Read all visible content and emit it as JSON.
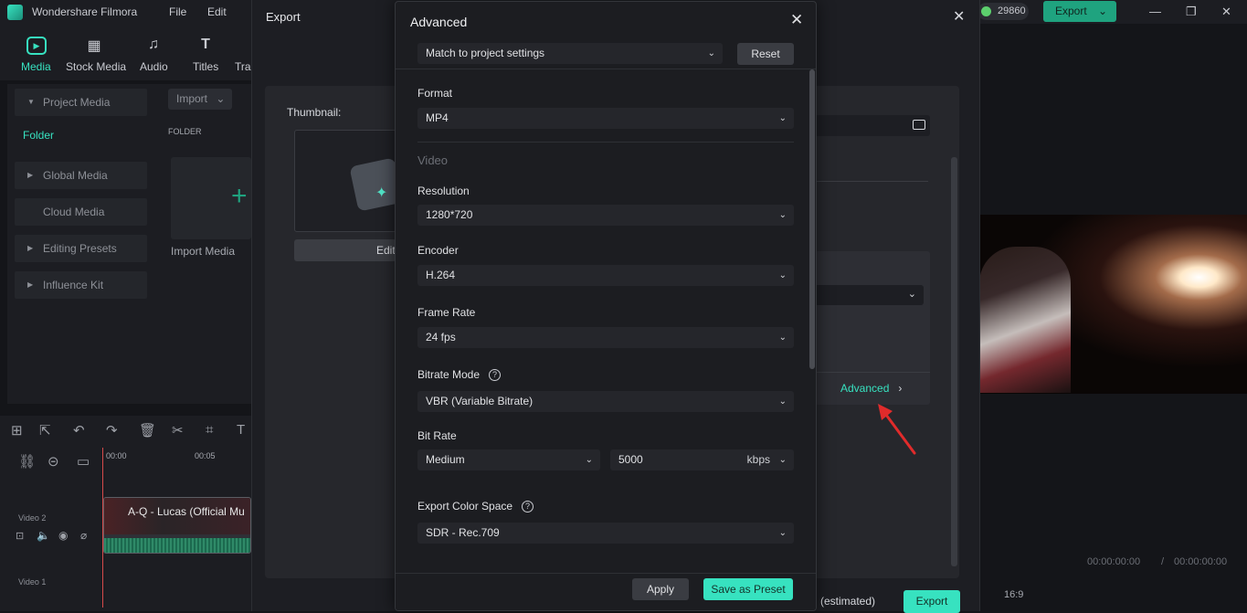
{
  "app": {
    "title": "Wondershare Filmora",
    "menu": [
      "File",
      "Edit"
    ],
    "credits": "29860",
    "export_label": "Export"
  },
  "media_tabs": [
    {
      "label": "Media",
      "icon": "media-icon"
    },
    {
      "label": "Stock Media",
      "icon": "stock-media-icon"
    },
    {
      "label": "Audio",
      "icon": "audio-icon"
    },
    {
      "label": "Titles",
      "icon": "titles-icon"
    },
    {
      "label": "Tra",
      "icon": "transitions-icon"
    }
  ],
  "sidebar": {
    "items": [
      {
        "label": "Project Media"
      },
      {
        "label": "Folder"
      },
      {
        "label": "Global Media"
      },
      {
        "label": "Cloud Media"
      },
      {
        "label": "Editing Presets"
      },
      {
        "label": "Influence Kit"
      }
    ],
    "import_label": "Import",
    "folder_header": "FOLDER",
    "import_media": "Import Media"
  },
  "timeline": {
    "ruler": [
      "00:00",
      "00:05"
    ],
    "tracks": [
      "Video 2",
      "Video 1"
    ],
    "clip_name": "A-Q - Lucas (Official Mu"
  },
  "preview": {
    "time_current": "00:00:00:00",
    "time_sep": "/",
    "time_total": "00:00:00:00",
    "ratio": "16:9"
  },
  "export_dialog": {
    "title": "Export",
    "thumbnail_label": "Thumbnail:",
    "edit_label": "Edit",
    "advanced_link": "Advanced",
    "estimated": "(estimated)",
    "export_button": "Export"
  },
  "advanced": {
    "title": "Advanced",
    "preset": "Match to project settings",
    "reset": "Reset",
    "format_label": "Format",
    "format": "MP4",
    "video_section": "Video",
    "resolution_label": "Resolution",
    "resolution": "1280*720",
    "encoder_label": "Encoder",
    "encoder": "H.264",
    "frame_rate_label": "Frame Rate",
    "frame_rate": "24 fps",
    "bitrate_mode_label": "Bitrate Mode",
    "bitrate_mode": "VBR (Variable Bitrate)",
    "bit_rate_label": "Bit Rate",
    "bit_rate_level": "Medium",
    "bit_rate_value": "5000",
    "bit_rate_unit": "kbps",
    "color_space_label": "Export Color Space",
    "color_space": "SDR - Rec.709",
    "apply": "Apply",
    "save_preset": "Save as Preset"
  }
}
